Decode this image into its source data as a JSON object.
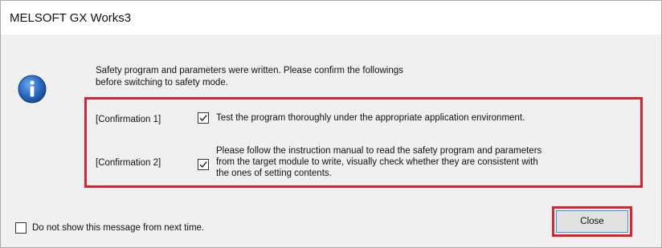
{
  "window": {
    "title": "MELSOFT GX Works3"
  },
  "message": {
    "line1": "Safety program and parameters were written. Please confirm the followings",
    "line2": "before switching to safety mode."
  },
  "confirmations": [
    {
      "label": "[Confirmation 1]",
      "checked": true,
      "text": [
        "Test the program thoroughly under the appropriate application environment."
      ]
    },
    {
      "label": "[Confirmation 2]",
      "checked": true,
      "text": [
        "Please follow the instruction manual to read the safety program and parameters",
        "from the target module to write, visually check whether they are consistent with",
        "the ones of setting contents."
      ]
    }
  ],
  "footer": {
    "dont_show_label": "Do not show this message from next time.",
    "dont_show_checked": false,
    "close_label": "Close"
  },
  "colors": {
    "highlight": "#e0202a",
    "info_icon": "#2b6cc4"
  },
  "icons": {
    "info": "info-icon",
    "check": "checkmark-icon"
  }
}
